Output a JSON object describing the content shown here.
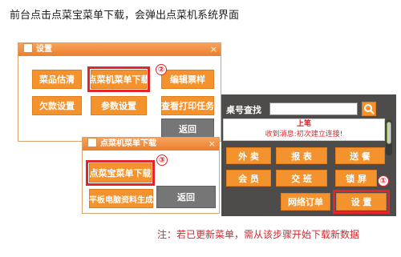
{
  "caption": "前台点击点菜宝菜单下载，会弹出点菜机系统界面",
  "note": "注：若已更新菜单，需从该步骤开始下载新数据",
  "settings_dialog": {
    "title": "设置",
    "close": "×",
    "buttons": [
      "菜品估清",
      "点菜机菜单下载",
      "编辑票样",
      "欠款设置",
      "参数设置",
      "查看打印任务"
    ],
    "back": "返回"
  },
  "download_dialog": {
    "title": "点菜机菜单下载",
    "close": "×",
    "buttons": [
      "点菜宝菜单下载",
      "平板电脑资料生成"
    ],
    "back": "返回"
  },
  "pos_panel": {
    "search_label": "桌号查找",
    "search_value": "",
    "message_title": "上笔",
    "message_text": "收到消息:初次建立连接!",
    "buttons": [
      "外 卖",
      "报 表",
      "送 餐",
      "会 员",
      "交 班",
      "锁 屏",
      "网络订单",
      "设 置"
    ]
  },
  "markers": [
    "①",
    "②",
    "③"
  ],
  "colors": {
    "accent_orange": "#f4922e",
    "highlight_red": "#e3242b",
    "panel_dark": "#4e4c4a",
    "back_gray": "#767676"
  },
  "icons": [
    "settings-icon",
    "search-icon",
    "close-icon"
  ]
}
